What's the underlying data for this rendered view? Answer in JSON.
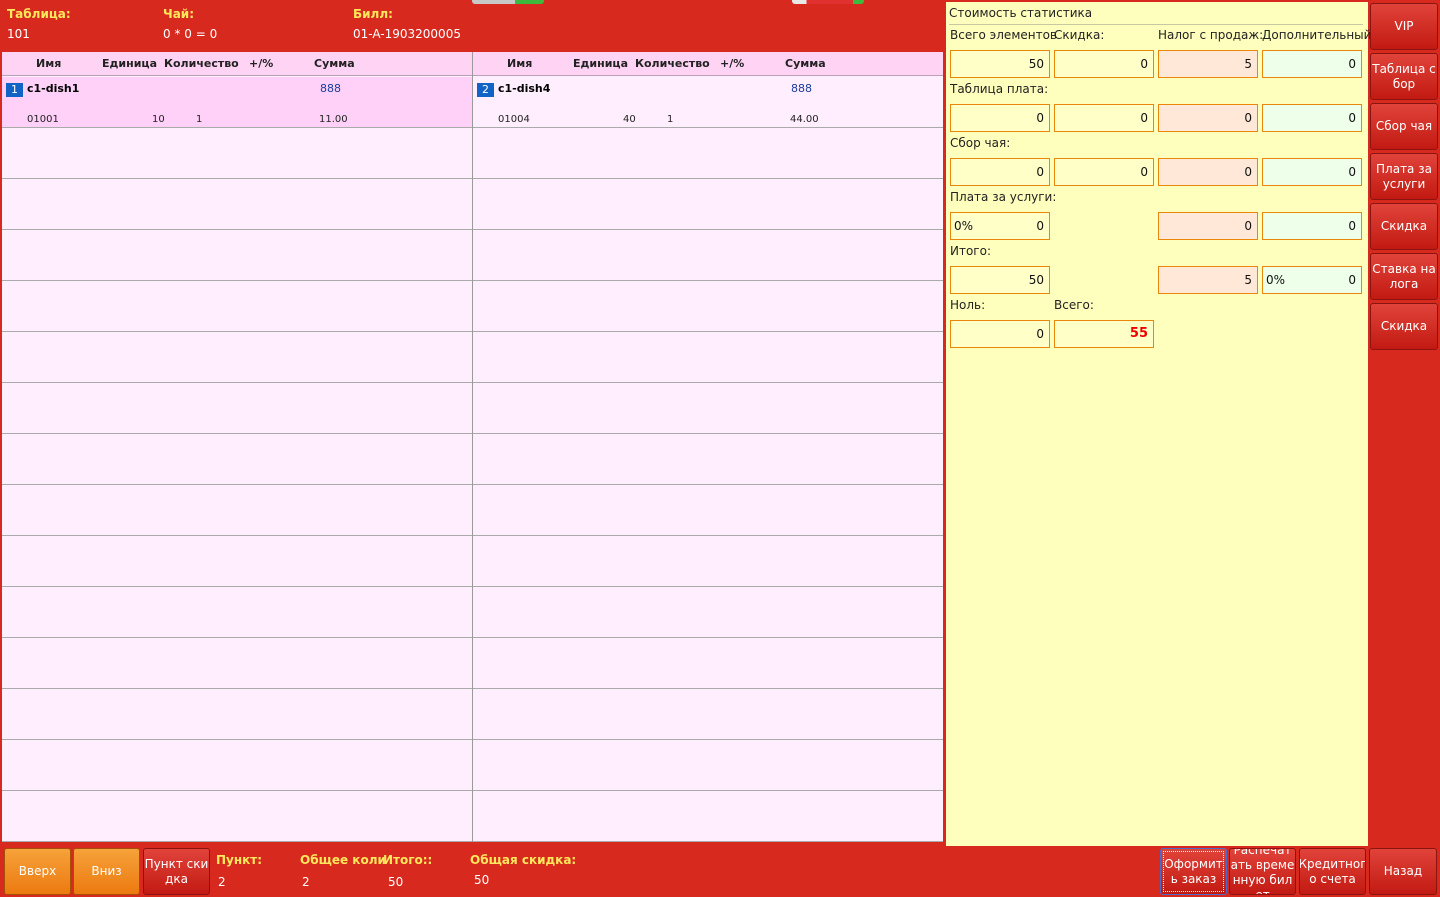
{
  "header": {
    "table_label": "Таблица:",
    "table_value": "101",
    "tea_label": "Чай:",
    "tea_value": "0 * 0 = 0",
    "bill_label": "Билл:",
    "bill_value": "01-A-1903200005"
  },
  "columns": {
    "name": "Имя",
    "unit": "Единица",
    "qty": "Количество",
    "pm": "+/%",
    "sum": "Сумма"
  },
  "items": [
    {
      "index": "1",
      "name": "c1-dish1",
      "price": "888",
      "code": "01001",
      "unit": "10",
      "qty": "1",
      "sum": "11.00"
    },
    {
      "index": "2",
      "name": "c1-dish4",
      "price": "888",
      "code": "01004",
      "unit": "40",
      "qty": "1",
      "sum": "44.00"
    }
  ],
  "stats": {
    "title": "Стоимость статистика",
    "col_labels": [
      "Всего элементов",
      "Скидка:",
      "Налог с продаж:",
      "Дополнительный"
    ],
    "table_fee_label": "Таблица плата:",
    "tea_fee_label": "Сбор чая:",
    "service_fee_label": "Плата за услуги:",
    "subtotal_label": "Итого:",
    "zero_label": "Ноль:",
    "total_label": "Всего:",
    "row_items": [
      "50",
      "0",
      "5",
      "0"
    ],
    "row_table_fee": [
      "0",
      "0",
      "0",
      "0"
    ],
    "row_tea_fee": [
      "0",
      "0",
      "0",
      "0"
    ],
    "row_service": {
      "pct": "0%",
      "value": "0",
      "tax": "0",
      "extra": "0"
    },
    "row_subtotal": {
      "value": "50",
      "tax": "5",
      "extra_pct": "0%",
      "extra": "0"
    },
    "zero_value": "0",
    "total_value": "55"
  },
  "side_buttons": [
    "VIP",
    "Таблица с бор",
    "Сбор чая",
    "Плата за услуги",
    "Скидка",
    "Ставка на лога",
    "Скидка"
  ],
  "footer": {
    "up": "Вверх",
    "down": "Вниз",
    "discount_item": "Пункт ски дка",
    "item_label": "Пункт:",
    "item_value": "2",
    "total_qty_label": "Общее коли",
    "total_qty_value": "2",
    "subtotal_label": "Итого::",
    "subtotal_value": "50",
    "total_discount_label": "Общая скидка:",
    "total_discount_value": "50",
    "place_order": "Оформит ь заказ",
    "print_temp": "Распечат ать време нную бил ет",
    "credit": "Кредитног о счета",
    "back": "Назад"
  }
}
